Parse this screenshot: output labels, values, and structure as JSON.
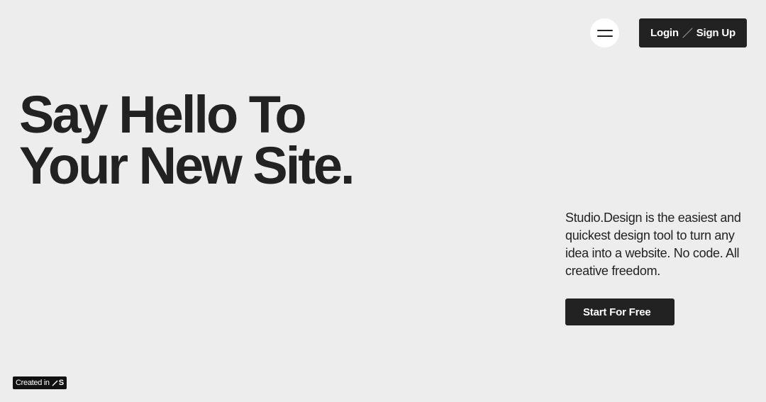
{
  "header": {
    "menu_icon": "hamburger-menu-icon",
    "login_label": "Login",
    "separator": "／",
    "signup_label": "Sign Up"
  },
  "hero": {
    "title_line1": "Say Hello To",
    "title_line2": "Your New Site."
  },
  "intro": {
    "description": "Studio.Design is the easiest and quickest design tool to turn any idea into a website. No code. All creative freedom.",
    "cta_label": "Start For Free"
  },
  "badge": {
    "created_label": "Created in",
    "logo_text": "S",
    "logo_icon": "studio-slash-logo"
  },
  "colors": {
    "background": "#ededed",
    "primary_dark": "#222222",
    "text_light": "#ffffff"
  }
}
